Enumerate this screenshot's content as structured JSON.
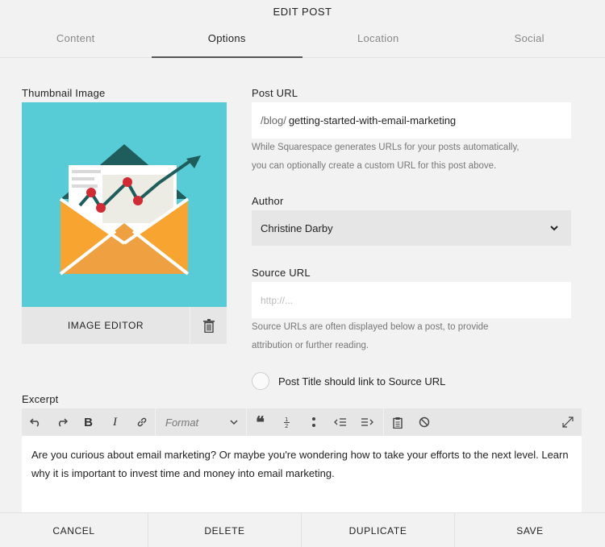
{
  "header": {
    "title": "EDIT POST"
  },
  "tabs": [
    {
      "label": "Content",
      "active": false
    },
    {
      "label": "Options",
      "active": true
    },
    {
      "label": "Location",
      "active": false
    },
    {
      "label": "Social",
      "active": false
    }
  ],
  "thumbnail": {
    "label": "Thumbnail Image",
    "image_editor_label": "IMAGE EDITOR",
    "background_color": "#58ccd6",
    "trash_icon": "trash-icon"
  },
  "post_url": {
    "label": "Post URL",
    "prefix": "/blog/",
    "value": "getting-started-with-email-marketing",
    "help_line1": "While Squarespace generates URLs for your posts automatically,",
    "help_line2": "you can optionally create a custom URL for this post above."
  },
  "author": {
    "label": "Author",
    "selected": "Christine Darby"
  },
  "source_url": {
    "label": "Source URL",
    "placeholder": "http://...",
    "value": "",
    "help_line1": "Source URLs are often displayed below a post, to provide",
    "help_line2": "attribution or further reading."
  },
  "link_option": {
    "label": "Post Title should link to Source URL",
    "checked": false
  },
  "excerpt": {
    "label": "Excerpt",
    "format_placeholder": "Format",
    "text": "Are you curious about email marketing? Or maybe you're wondering how to take your efforts to the next level. Learn why it is important to invest time and money into email marketing."
  },
  "footer": {
    "cancel": "CANCEL",
    "delete": "DELETE",
    "duplicate": "DUPLICATE",
    "save": "SAVE"
  },
  "colors": {
    "tab_indicator": "#555555",
    "thumbnail_bg": "#58ccd6",
    "envelope_orange": "#f7a430",
    "chart_red": "#d12b35",
    "arrow_teal": "#1f5c5c"
  }
}
